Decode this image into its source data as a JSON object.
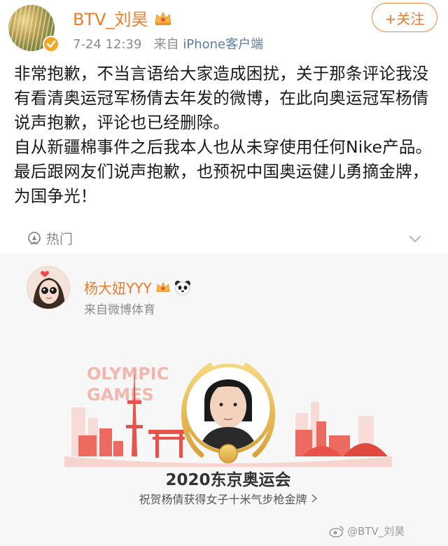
{
  "post": {
    "username": "BTV_刘昊",
    "time": "7-24 12:39",
    "source_prefix": "来自",
    "source_device": "iPhone客户端",
    "follow_label": "+关注",
    "paragraphs": [
      "非常抱歉，不当言语给大家造成困扰，关于那条评论我没有看清奥运冠军杨倩去年发的微博，在此向奥运冠军杨倩说声抱歉，评论也已经删除。",
      "自从新疆棉事件之后我本人也从未穿使用任何Nike产品。",
      "最后跟网友们说声抱歉，也预祝中国奥运健儿勇摘金牌，为国争光！"
    ],
    "hot_label": "热门"
  },
  "quoted": {
    "username": "杨大妞YYY",
    "source": "来自微博体育",
    "banner_text_line1": "OLYMPIC",
    "banner_text_line2": "GAMES",
    "card_title": "2020东京奥运会",
    "card_subtitle": "祝贺杨倩获得女子十米气步枪金牌"
  },
  "watermark": "@BTV_刘昊",
  "colors": {
    "accent": "#ef7b2c",
    "meta_gray": "#8c8c8c",
    "link_blue": "#5a7ea8",
    "banner_red": "#e8524a",
    "gold": "#e7b84a"
  }
}
